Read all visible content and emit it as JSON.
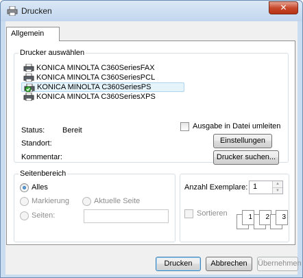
{
  "window": {
    "title": "Drucken",
    "close_glyph": "✕"
  },
  "tabs": [
    {
      "label": "Allgemein"
    }
  ],
  "printer_group": {
    "legend": "Drucker auswählen",
    "printers": [
      {
        "name": "KONICA MINOLTA C360SeriesFAX",
        "icon": "printer-icon",
        "selected": false
      },
      {
        "name": "KONICA MINOLTA C360SeriesPCL",
        "icon": "printer-icon",
        "selected": false
      },
      {
        "name": "KONICA MINOLTA C360SeriesPS",
        "icon": "printer-default-icon",
        "selected": true
      },
      {
        "name": "KONICA MINOLTA C360SeriesXPS",
        "icon": "printer-icon",
        "selected": false
      }
    ],
    "status_label": "Status:",
    "status_value": "Bereit",
    "location_label": "Standort:",
    "comment_label": "Kommentar:",
    "print_to_file_label": "Ausgabe in Datei umleiten",
    "settings_button": "Einstellungen",
    "find_printer_button": "Drucker suchen..."
  },
  "page_range": {
    "legend": "Seitenbereich",
    "all_label": "Alles",
    "selection_label": "Markierung",
    "current_page_label": "Aktuelle Seite",
    "pages_label": "Seiten:",
    "pages_value": ""
  },
  "copies": {
    "label": "Anzahl Exemplare:",
    "value": "1",
    "collate_label": "Sortieren",
    "pages": [
      "1",
      "1",
      "2",
      "2",
      "3",
      "3"
    ]
  },
  "footer": {
    "print_button": "Drucken",
    "cancel_button": "Abbrechen",
    "apply_button": "Übernehmen"
  }
}
